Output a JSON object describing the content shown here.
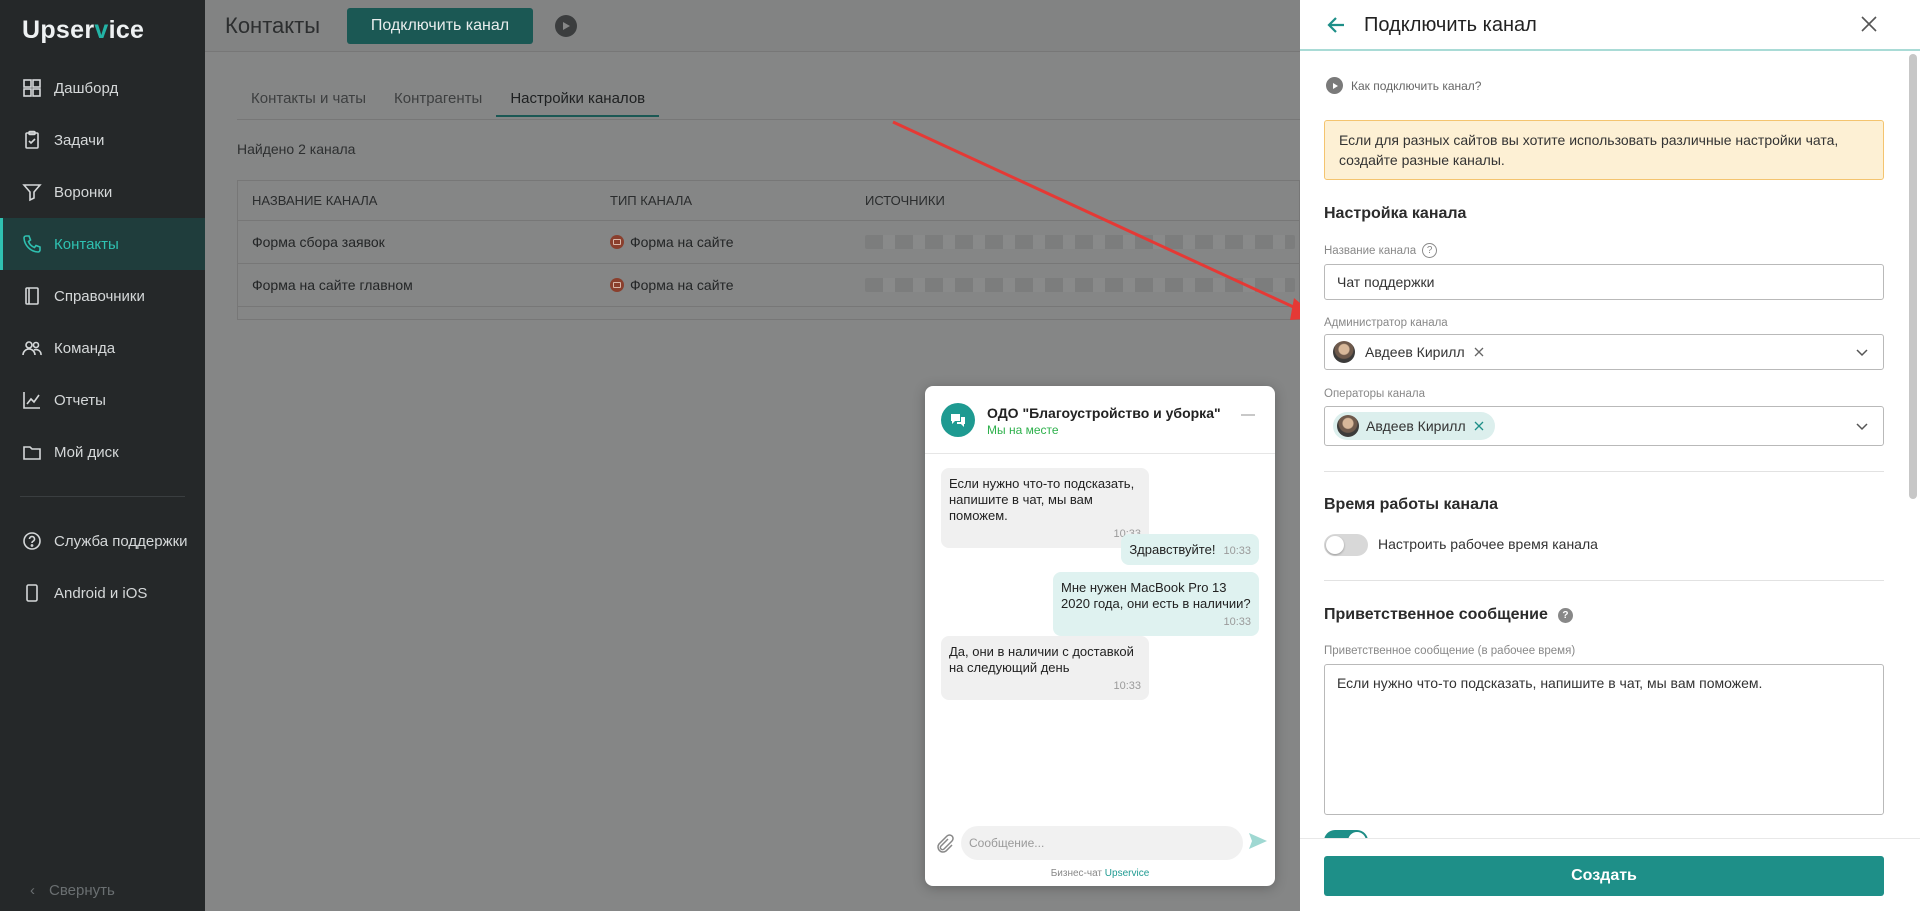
{
  "app": {
    "logo_text_1": "Upser",
    "logo_check": "v",
    "logo_text_2": "ice"
  },
  "sidebar": {
    "items": [
      {
        "label": "Дашборд",
        "icon": "dashboard-icon"
      },
      {
        "label": "Задачи",
        "icon": "tasks-icon"
      },
      {
        "label": "Воронки",
        "icon": "funnel-icon"
      },
      {
        "label": "Контакты",
        "icon": "phone-icon",
        "active": true
      },
      {
        "label": "Справочники",
        "icon": "book-icon"
      },
      {
        "label": "Команда",
        "icon": "team-icon"
      },
      {
        "label": "Отчеты",
        "icon": "chart-icon"
      },
      {
        "label": "Мой диск",
        "icon": "folder-icon"
      }
    ],
    "bottom_items": [
      {
        "label": "Служба поддержки",
        "icon": "help-icon"
      },
      {
        "label": "Android и iOS",
        "icon": "mobile-icon"
      }
    ],
    "collapse_label": "Свернуть"
  },
  "header": {
    "title": "Контакты",
    "connect_button": "Подключить канал"
  },
  "tabs": [
    "Контакты и чаты",
    "Контрагенты",
    "Настройки каналов"
  ],
  "found_text": "Найдено 2 канала",
  "table": {
    "columns": [
      "Название канала",
      "Тип канала",
      "Источники"
    ],
    "rows": [
      {
        "name": "Форма сбора заявок",
        "type": "Форма на сайте"
      },
      {
        "name": "Форма на сайте главном",
        "type": "Форма на сайте"
      }
    ]
  },
  "chat": {
    "title": "ОДО \"Благоустройство и уборка\"",
    "status": "Мы на месте",
    "messages": [
      {
        "dir": "in",
        "text": "Если нужно что-то подсказать, напишите в чат, мы вам поможем.",
        "time": "10:33"
      },
      {
        "dir": "out",
        "text": "Здравствуйте!",
        "time": "10:33"
      },
      {
        "dir": "out",
        "text": "Мне нужен MacBook Pro 13 2020 года, они есть в наличии?",
        "time": "10:33"
      },
      {
        "dir": "in",
        "text": "Да, они в наличии с доставкой на следующий день",
        "time": "10:33"
      }
    ],
    "input_placeholder": "Сообщение...",
    "footer_prefix": "Бизнес-чат",
    "footer_brand": "Upservice"
  },
  "panel": {
    "title": "Подключить канал",
    "help_link": "Как подключить канал?",
    "notice": "Если для разных сайтов вы хотите использовать различные настройки чата, создайте разные каналы.",
    "section_channel": "Настройка канала",
    "name_label": "Название канала",
    "name_value": "Чат поддержки",
    "admin_label": "Администратор канала",
    "admin_value": "Авдеев Кирилл",
    "operators_label": "Операторы канала",
    "operator_value": "Авдеев Кирилл",
    "section_hours": "Время работы канала",
    "hours_toggle_label": "Настроить рабочее время канала",
    "section_greeting": "Приветственное сообщение",
    "greeting_label": "Приветственное сообщение (в рабочее время)",
    "greeting_value": "Если нужно что-то подсказать, напишите в чат, мы вам поможем.",
    "create_button": "Создать"
  },
  "colors": {
    "accent": "#1e8f88",
    "arrow": "#e53935",
    "notice_bg": "#fdf0d4"
  }
}
